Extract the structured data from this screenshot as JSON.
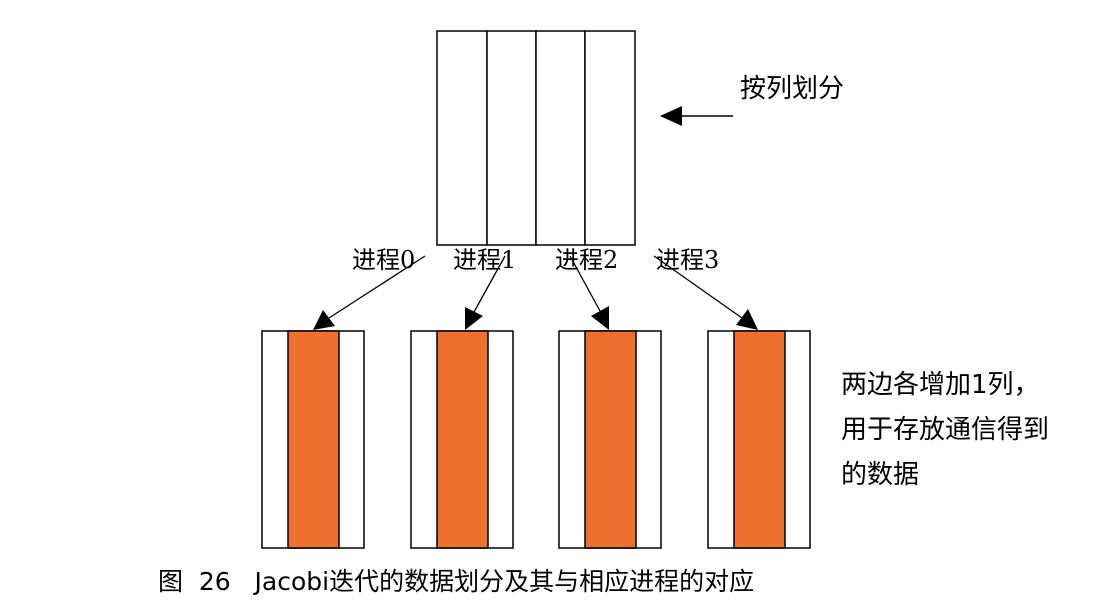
{
  "diagram": {
    "split_label": "按列划分",
    "process_labels": [
      "进程0",
      "进程1",
      "进程2",
      "进程3"
    ],
    "note_lines": [
      "两边各增加1列，",
      "用于存放通信得到",
      "的数据"
    ],
    "caption": "图  26   Jacobi迭代的数据划分及其与相应进程的对应"
  },
  "colors": {
    "highlight": "#ed7030",
    "stroke": "#000000"
  }
}
